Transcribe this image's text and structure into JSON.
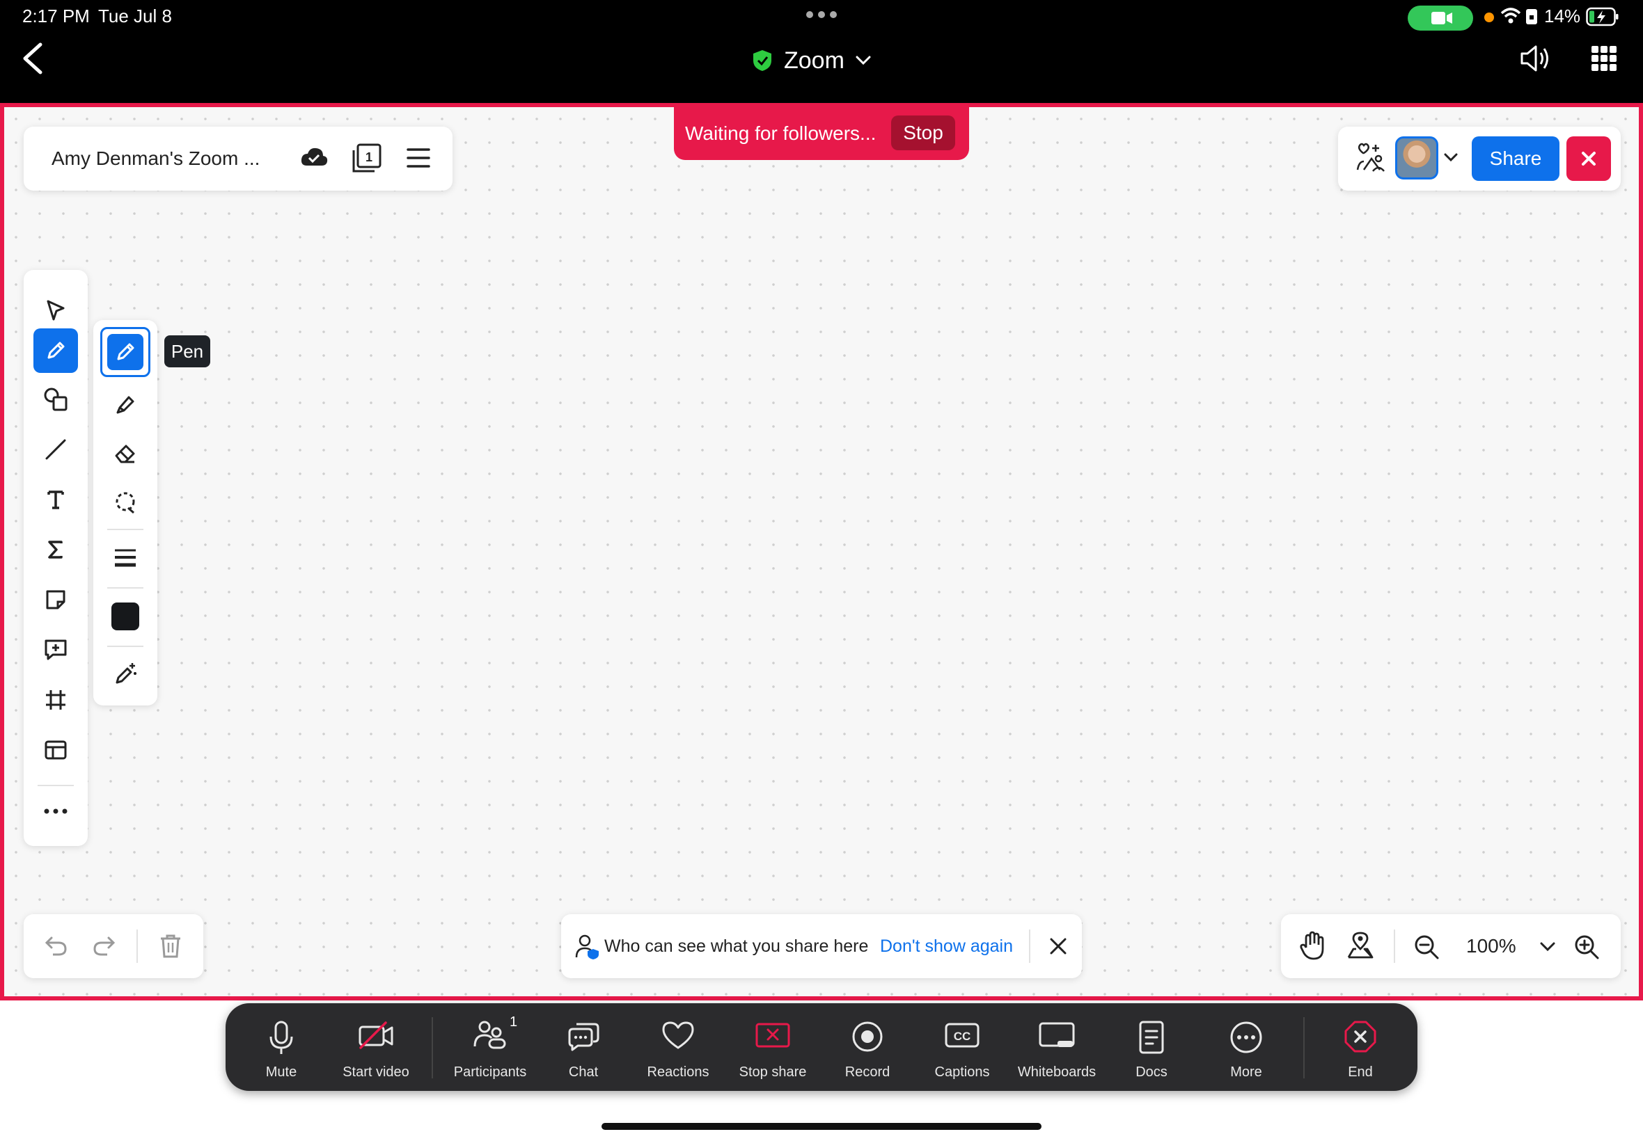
{
  "status_bar": {
    "time": "2:17 PM",
    "date": "Tue Jul 8",
    "battery": "14%"
  },
  "header": {
    "title": "Zoom",
    "icons": [
      "back-chevron-icon",
      "shield-check-icon",
      "chevron-down-icon",
      "speaker-icon",
      "app-grid-icon"
    ]
  },
  "whiteboard": {
    "name": "Amy Denman's Zoom ...",
    "follow_banner": {
      "text": "Waiting for followers...",
      "stop_label": "Stop"
    },
    "share_label": "Share",
    "tooltip": "Pen",
    "notice": {
      "text": "Who can see what you share here",
      "link": "Don't show again"
    },
    "zoom_level": "100%",
    "pen_color": "#16181b",
    "accent": "#0e71eb",
    "border_color": "#e7194a"
  },
  "meeting_bar": {
    "items": [
      {
        "label": "Mute",
        "icon": "microphone-icon"
      },
      {
        "label": "Start video",
        "icon": "video-off-icon"
      },
      {
        "label": "Participants",
        "icon": "participants-icon",
        "badge": "1"
      },
      {
        "label": "Chat",
        "icon": "chat-icon"
      },
      {
        "label": "Reactions",
        "icon": "heart-icon"
      },
      {
        "label": "Stop share",
        "icon": "stop-share-icon"
      },
      {
        "label": "Record",
        "icon": "record-icon"
      },
      {
        "label": "Captions",
        "icon": "cc-icon"
      },
      {
        "label": "Whiteboards",
        "icon": "whiteboard-icon"
      },
      {
        "label": "Docs",
        "icon": "docs-icon"
      },
      {
        "label": "More",
        "icon": "more-icon"
      },
      {
        "label": "End",
        "icon": "end-icon"
      }
    ]
  }
}
